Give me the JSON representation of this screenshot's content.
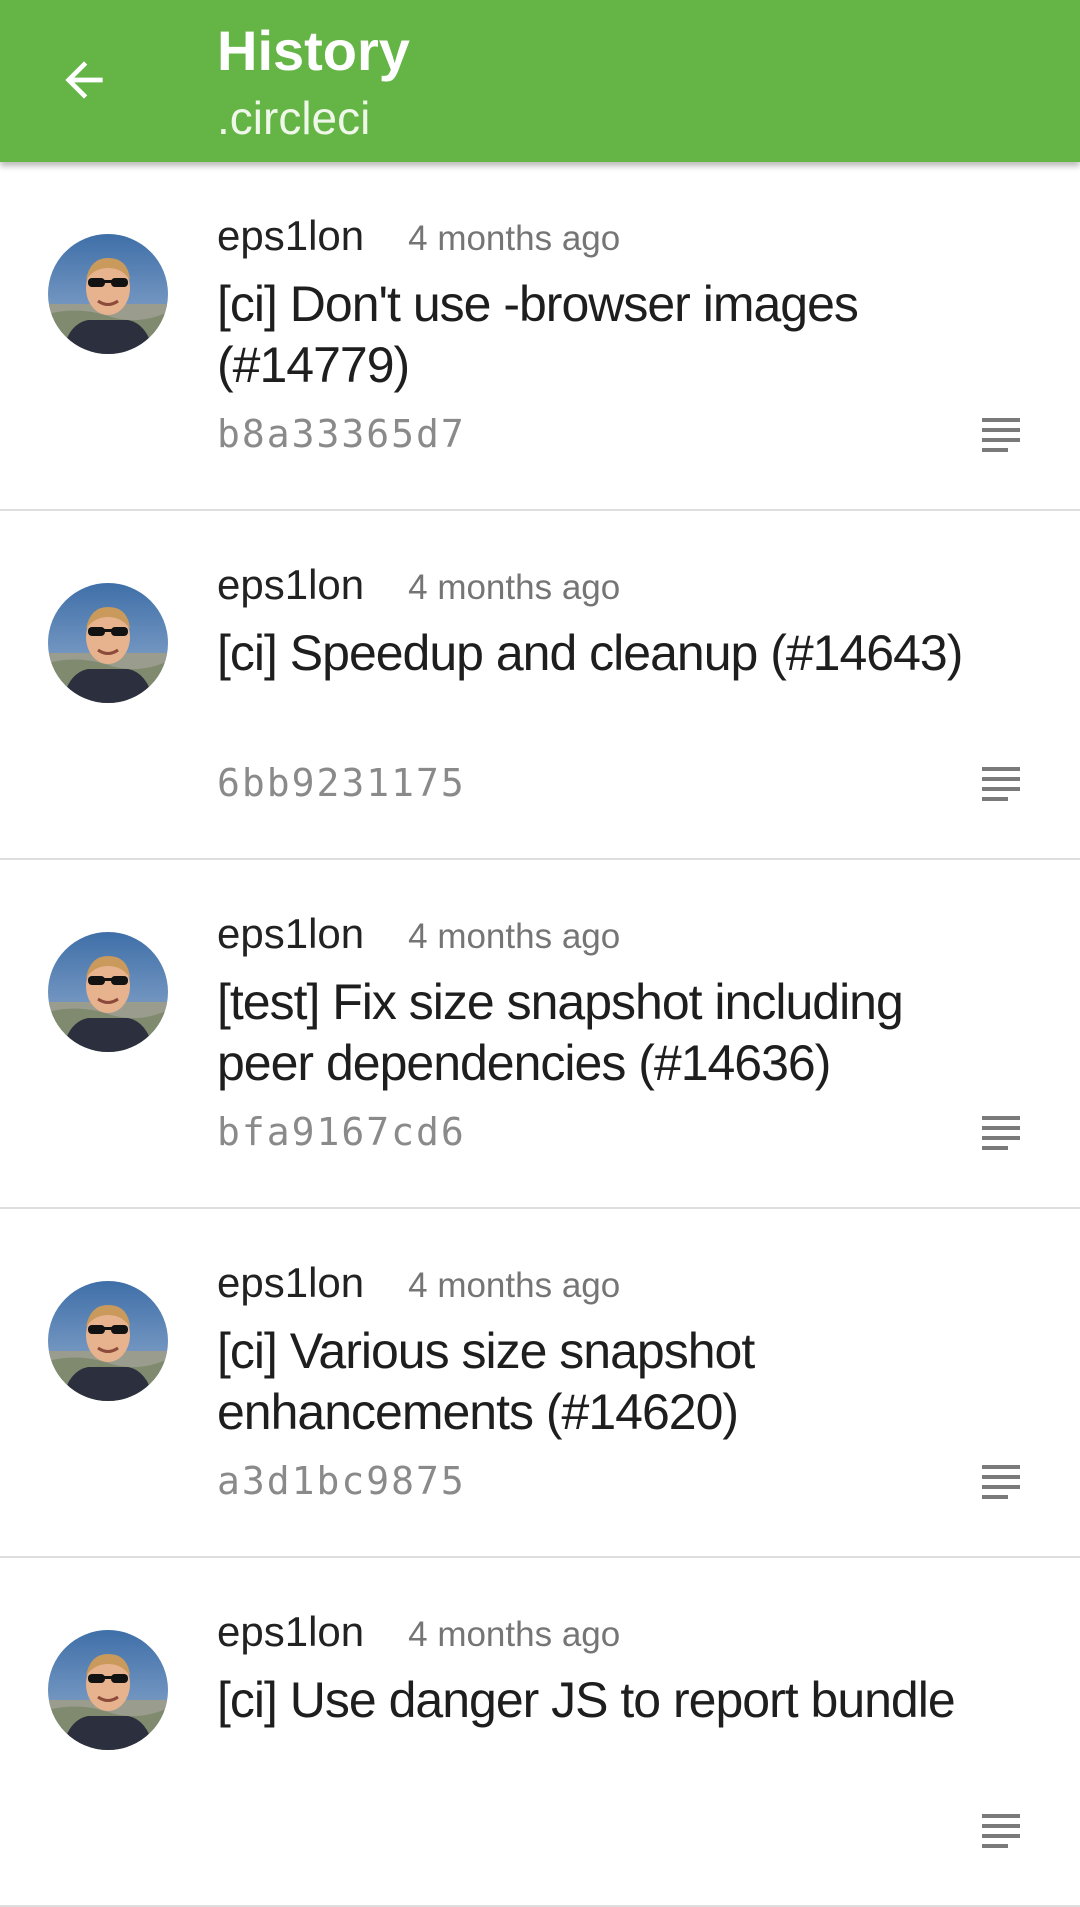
{
  "appbar": {
    "title": "History",
    "subtitle": ".circleci",
    "back_icon": "arrow-back-icon",
    "color": "#65b446"
  },
  "commits": [
    {
      "author": "eps1lon",
      "time": "4 months ago",
      "message": "[ci] Don't use -browser images (#14779)",
      "sha": "b8a33365d7",
      "icon": "details-icon"
    },
    {
      "author": "eps1lon",
      "time": "4 months ago",
      "message": "[ci] Speedup and cleanup (#14643)",
      "sha": "6bb9231175",
      "icon": "details-icon"
    },
    {
      "author": "eps1lon",
      "time": "4 months ago",
      "message": "[test] Fix size snapshot including peer dependencies (#14636)",
      "sha": "bfa9167cd6",
      "icon": "details-icon"
    },
    {
      "author": "eps1lon",
      "time": "4 months ago",
      "message": "[ci] Various size snapshot enhancements (#14620)",
      "sha": "a3d1bc9875",
      "icon": "details-icon"
    },
    {
      "author": "eps1lon",
      "time": "4 months ago",
      "message": "[ci] Use danger JS to report bundle",
      "sha": "",
      "icon": "details-icon"
    }
  ]
}
